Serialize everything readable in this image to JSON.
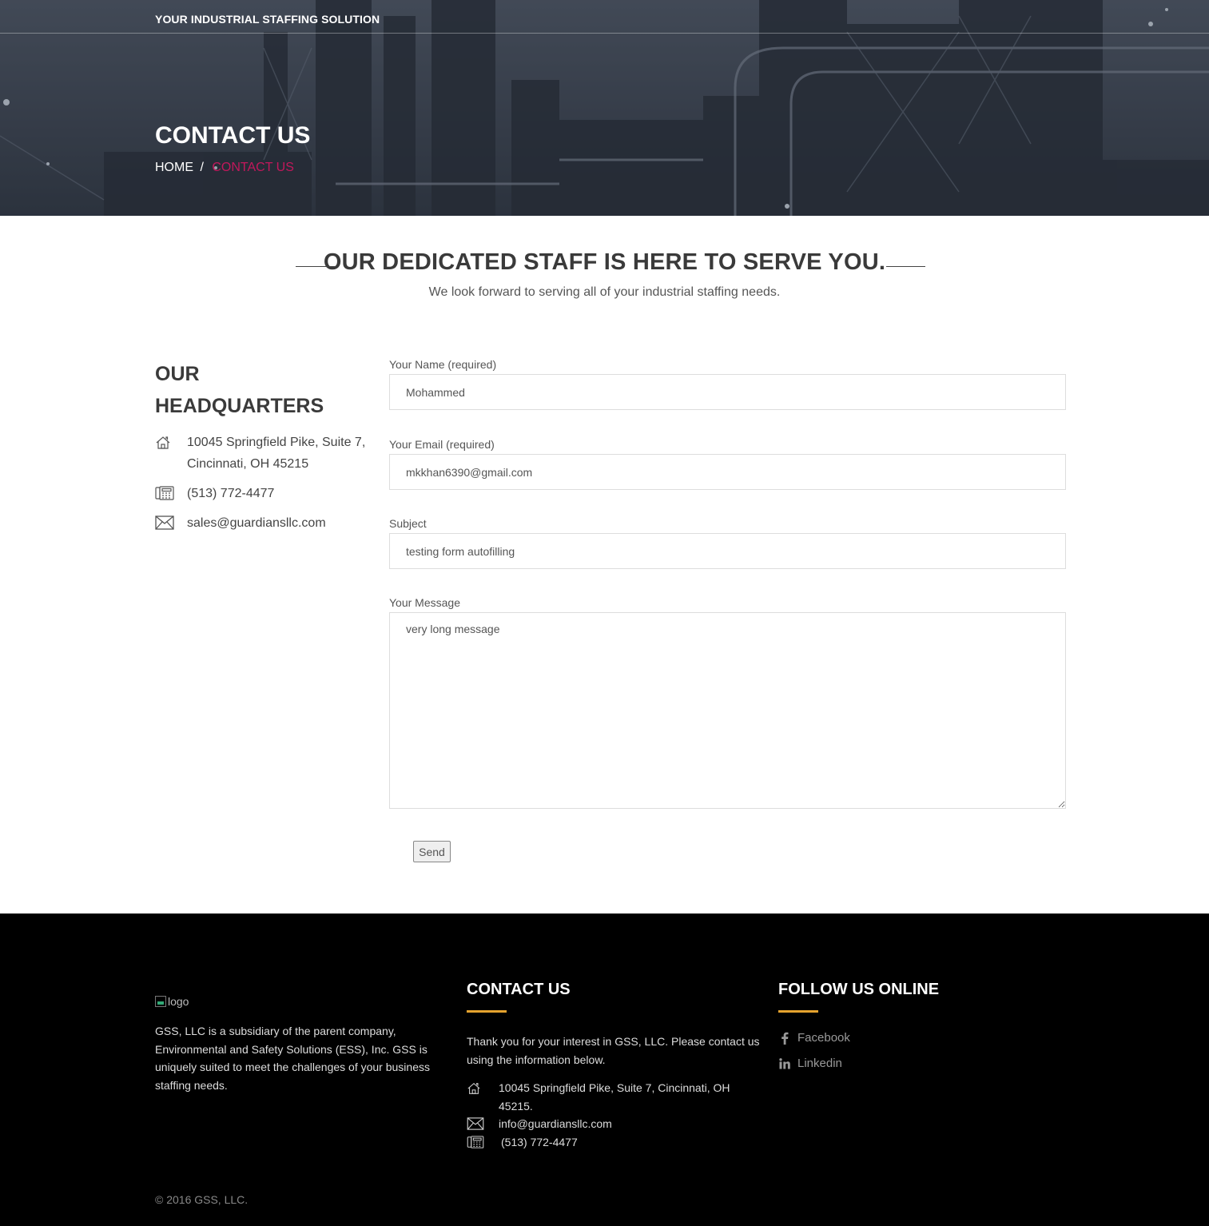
{
  "header": {
    "tagline": "YOUR INDUSTRIAL STAFFING SOLUTION",
    "title": "CONTACT US",
    "breadcrumb": {
      "home": "HOME",
      "separator": "/",
      "current": "CONTACT US"
    }
  },
  "intro": {
    "heading": "OUR DEDICATED STAFF IS HERE TO SERVE YOU.",
    "subheading": "We look forward to serving all of your industrial staffing needs."
  },
  "headquarters": {
    "title_line1": "OUR",
    "title_line2": "HEADQUARTERS",
    "address": "10045 Springfield Pike, Suite 7, Cincinnati, OH 45215",
    "phone": "(513) 772-4477",
    "email": "sales@guardiansllc.com"
  },
  "form": {
    "name_label": "Your Name (required)",
    "name_value": "Mohammed",
    "email_label": "Your Email (required)",
    "email_value": "mkkhan6390@gmail.com",
    "subject_label": "Subject",
    "subject_value": "testing form autofilling",
    "message_label": "Your Message",
    "message_value": "very long message",
    "send_label": "Send"
  },
  "footer": {
    "logo_alt": "logo",
    "about": "GSS, LLC is a subsidiary of the parent company, Environmental and Safety Solutions (ESS), Inc.  GSS is uniquely suited to meet the challenges of your business staffing needs.",
    "contact_heading": "CONTACT US",
    "contact_intro": "Thank you for your interest in GSS, LLC. Please contact us using the information below.",
    "address": "10045 Springfield Pike, Suite 7, Cincinnati, OH 45215.",
    "email": "info@guardiansllc.com",
    "phone": "(513) 772-4477",
    "follow_heading": "FOLLOW US ONLINE",
    "facebook": "Facebook",
    "linkedin": "Linkedin",
    "copyright": "© 2016 GSS, LLC.",
    "accent_color": "#e5a32e"
  },
  "colors": {
    "breadcrumb_current": "#c2185b",
    "footer_bg": "#000000"
  }
}
